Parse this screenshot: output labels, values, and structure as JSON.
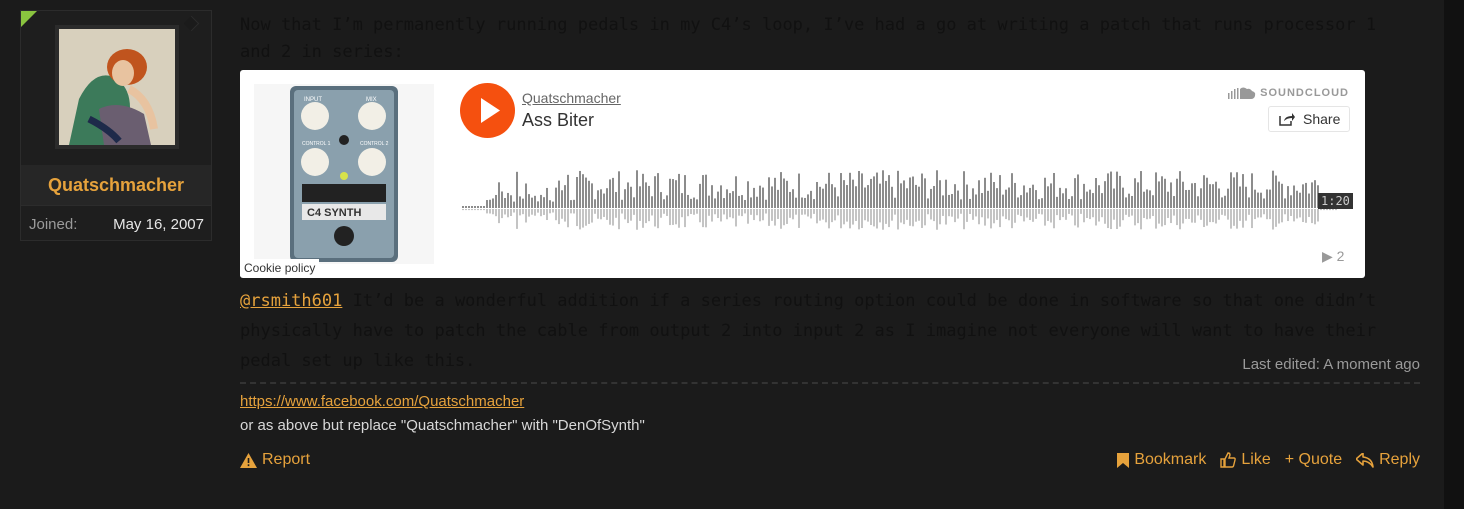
{
  "user": {
    "name": "Quatschmacher",
    "joined_label": "Joined:",
    "joined_value": "May 16, 2007"
  },
  "post": {
    "intro": "Now that I’m permanently running pedals in my C4’s loop, I’ve had a go at writing a patch that runs processor 1 and 2 in series:",
    "mention": "@rsmith601",
    "body": " It’d be a wonderful addition if a series routing option could be done in software so that one didn’t physically have to patch the cable from output 2 into input 2 as I imagine not everyone will want to have their pedal set up like this.",
    "last_edited": "Last edited: A moment ago"
  },
  "embed": {
    "artist": "Quatschmacher",
    "track": "Ass Biter",
    "brand": "SOUNDCLOUD",
    "share_label": "Share",
    "duration": "1:20",
    "plays": "2",
    "cookie_policy": "Cookie policy",
    "artwork_labels": {
      "input": "INPUT",
      "mix": "MIX",
      "control1": "CONTROL 1",
      "control2": "CONTROL 2",
      "brand": "C4 SYNTH"
    },
    "play_color": "#f5500f"
  },
  "signature": {
    "link": "https://www.facebook.com/Quatschmacher",
    "text": "or as above but replace \"Quatschmacher\" with \"DenOfSynth\""
  },
  "actions": {
    "report": "Report",
    "bookmark": "Bookmark",
    "like": "Like",
    "quote": "+ Quote",
    "reply": "Reply"
  },
  "colors": {
    "accent": "#e6a23c",
    "background": "#1b1b1b",
    "corner_badge": "#8ac43f"
  }
}
